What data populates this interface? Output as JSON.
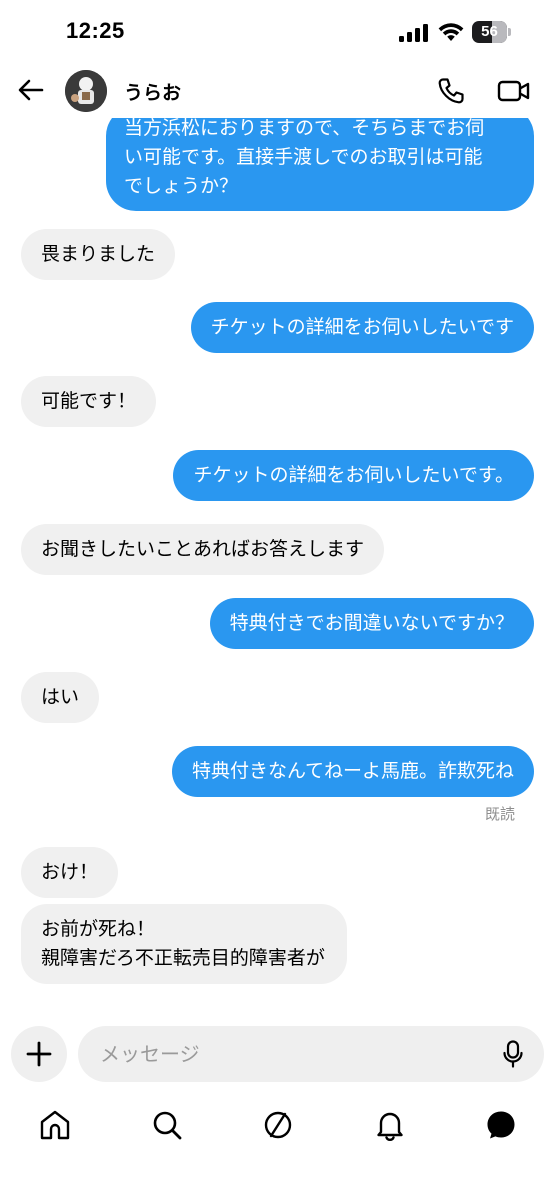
{
  "status_bar": {
    "time": "12:25",
    "battery_level": "56",
    "battery_fraction": 0.56
  },
  "header": {
    "back_icon": "arrow-left-icon",
    "contact_name": "うらお",
    "call_icon": "phone-icon",
    "video_icon": "video-camera-icon"
  },
  "messages": [
    {
      "direction": "out",
      "text": "当方浜松におりますので、そちらまでお伺\nい可能です。直接手渡しでのお取引は可能\nでしょうか？"
    },
    {
      "direction": "in",
      "text": "畏まりました"
    },
    {
      "direction": "out",
      "text": "チケットの詳細をお伺いしたいです"
    },
    {
      "direction": "in",
      "text": "可能です！"
    },
    {
      "direction": "out",
      "text": "チケットの詳細をお伺いしたいです。"
    },
    {
      "direction": "in",
      "text": "お聞きしたいことあればお答えします"
    },
    {
      "direction": "out",
      "text": "特典付きでお間違いないですか？"
    },
    {
      "direction": "in",
      "text": "はい"
    },
    {
      "direction": "out",
      "text": "特典付きなんてねーよ馬鹿。詐欺死ね"
    },
    {
      "direction": "in",
      "text": "おけ！"
    },
    {
      "direction": "in",
      "text": "お前が死ね！\n親障害だろ不正転売目的障害者が"
    }
  ],
  "read_receipt": "既読",
  "composer": {
    "add_icon": "plus-icon",
    "placeholder": "メッセージ",
    "mic_icon": "microphone-icon"
  },
  "bottom_nav": [
    {
      "name": "home",
      "icon": "home-icon"
    },
    {
      "name": "search",
      "icon": "search-icon"
    },
    {
      "name": "explore",
      "icon": "explore-icon"
    },
    {
      "name": "notifications",
      "icon": "bell-icon"
    },
    {
      "name": "messages",
      "icon": "chat-bubble-icon",
      "active": true
    }
  ],
  "colors": {
    "outgoing_bubble": "#2a97f0",
    "incoming_bubble": "#f0f0f0",
    "background": "#ffffff"
  }
}
